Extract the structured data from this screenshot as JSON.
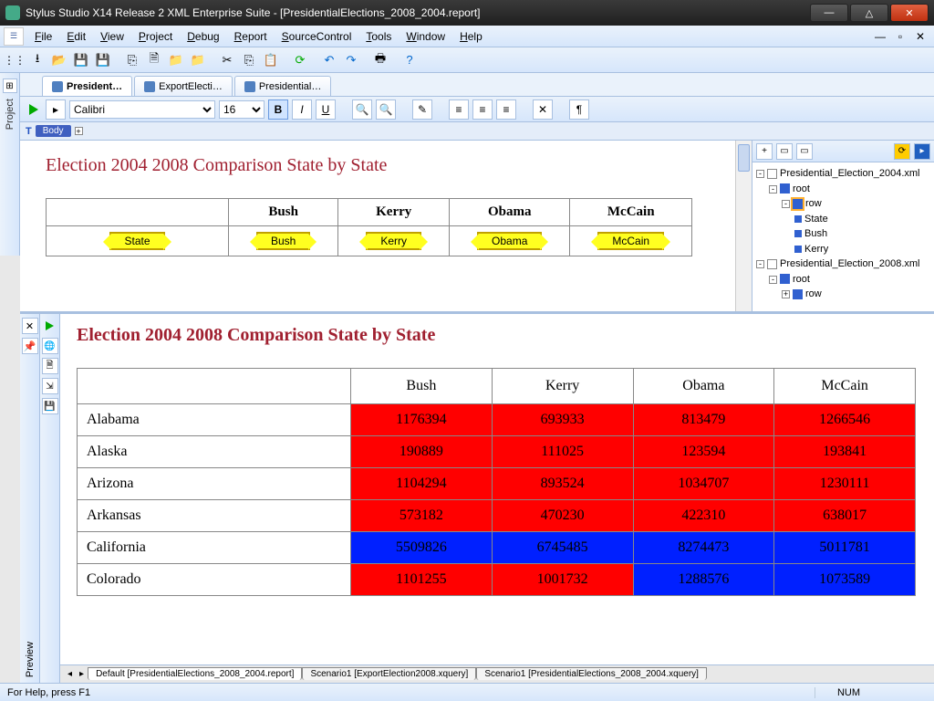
{
  "window": {
    "title": "Stylus Studio X14 Release 2 XML Enterprise Suite - [PresidentialElections_2008_2004.report]"
  },
  "menu": {
    "items": [
      "File",
      "Edit",
      "View",
      "Project",
      "Debug",
      "Report",
      "SourceControl",
      "Tools",
      "Window",
      "Help"
    ]
  },
  "doc_tabs": [
    {
      "label": "President…",
      "active": true
    },
    {
      "label": "ExportElecti…",
      "active": false
    },
    {
      "label": "Presidential…",
      "active": false
    }
  ],
  "format_toolbar": {
    "font": "Calibri",
    "size": "16"
  },
  "body_strip": {
    "tag": "Body"
  },
  "left_rail": {
    "label": "Project"
  },
  "design": {
    "title": "Election 2004 2008 Comparison State by State",
    "headers": [
      "Bush",
      "Kerry",
      "Obama",
      "McCain"
    ],
    "row_field": "State",
    "fields": [
      "Bush",
      "Kerry",
      "Obama",
      "McCain"
    ]
  },
  "tree": {
    "files": [
      {
        "name": "Presidential_Election_2004.xml",
        "root": "root",
        "row": "row",
        "row_selected": true,
        "leaves": [
          "State",
          "Bush",
          "Kerry"
        ]
      },
      {
        "name": "Presidential_Election_2008.xml",
        "root": "root",
        "row": "row",
        "row_selected": false,
        "leaves": []
      }
    ]
  },
  "preview": {
    "title": "Election 2004 2008 Comparison  State by State",
    "columns": [
      "",
      "Bush",
      "Kerry",
      "Obama",
      "McCain"
    ],
    "left_label": "Preview",
    "bottom_tabs": [
      "Default [PresidentialElections_2008_2004.report]",
      "Scenario1 [ExportElection2008.xquery]",
      "Scenario1 [PresidentialElections_2008_2004.xquery]"
    ]
  },
  "chart_data": {
    "type": "table",
    "columns": [
      "State",
      "Bush",
      "Kerry",
      "Obama",
      "McCain"
    ],
    "rows": [
      {
        "state": "Alabama",
        "bush": 1176394,
        "kerry": 693933,
        "obama": 813479,
        "mccain": 1266546,
        "colors": [
          "red",
          "red",
          "red",
          "red"
        ]
      },
      {
        "state": "Alaska",
        "bush": 190889,
        "kerry": 111025,
        "obama": 123594,
        "mccain": 193841,
        "colors": [
          "red",
          "red",
          "red",
          "red"
        ]
      },
      {
        "state": "Arizona",
        "bush": 1104294,
        "kerry": 893524,
        "obama": 1034707,
        "mccain": 1230111,
        "colors": [
          "red",
          "red",
          "red",
          "red"
        ]
      },
      {
        "state": "Arkansas",
        "bush": 573182,
        "kerry": 470230,
        "obama": 422310,
        "mccain": 638017,
        "colors": [
          "red",
          "red",
          "red",
          "red"
        ]
      },
      {
        "state": "California",
        "bush": 5509826,
        "kerry": 6745485,
        "obama": 8274473,
        "mccain": 5011781,
        "colors": [
          "blue",
          "blue",
          "blue",
          "blue"
        ]
      },
      {
        "state": "Colorado",
        "bush": 1101255,
        "kerry": 1001732,
        "obama": 1288576,
        "mccain": 1073589,
        "colors": [
          "red",
          "red",
          "blue",
          "blue"
        ]
      }
    ]
  },
  "status": {
    "hint": "For Help, press F1",
    "num": "NUM"
  }
}
